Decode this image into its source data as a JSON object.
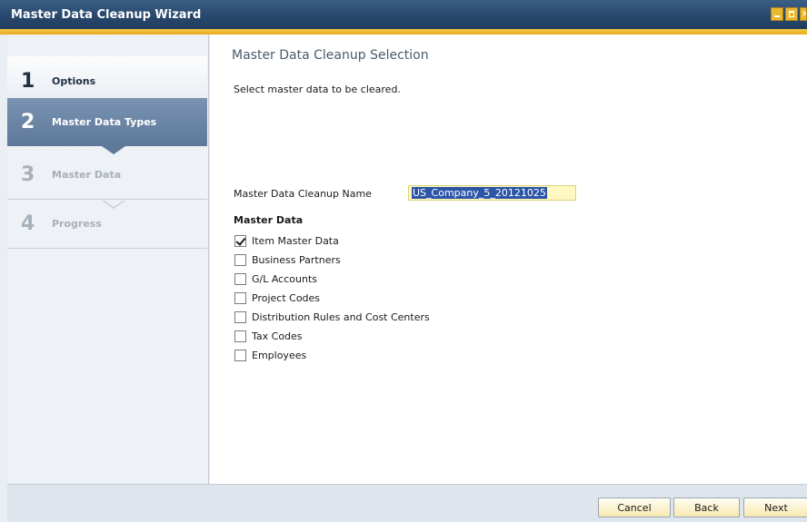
{
  "window": {
    "title": "Master Data Cleanup Wizard"
  },
  "steps": [
    {
      "num": "1",
      "label": "Options",
      "state": "done"
    },
    {
      "num": "2",
      "label": "Master Data Types",
      "state": "active"
    },
    {
      "num": "3",
      "label": "Master Data",
      "state": "pending"
    },
    {
      "num": "4",
      "label": "Progress",
      "state": "pending"
    }
  ],
  "content": {
    "heading": "Master Data Cleanup Selection",
    "description": "Select master data to be cleared.",
    "cleanup_name_label": "Master Data Cleanup Name",
    "cleanup_name_value": "US_Company_5_20121025",
    "master_data_heading": "Master Data",
    "options": [
      {
        "label": "Item Master Data",
        "checked": true
      },
      {
        "label": "Business Partners",
        "checked": false
      },
      {
        "label": "G/L Accounts",
        "checked": false
      },
      {
        "label": "Project Codes",
        "checked": false
      },
      {
        "label": "Distribution Rules and Cost Centers",
        "checked": false
      },
      {
        "label": "Tax Codes",
        "checked": false
      },
      {
        "label": "Employees",
        "checked": false
      }
    ]
  },
  "footer": {
    "cancel_label": "Cancel",
    "back_label": "Back",
    "next_label": "Next"
  },
  "colors": {
    "titlebar": "#26466a",
    "accent": "#e9a91e",
    "active_step": "#5d7899",
    "input_bg": "#fff8c2"
  }
}
